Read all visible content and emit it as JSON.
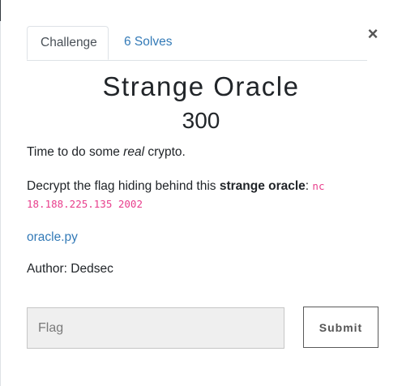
{
  "modal": {
    "close_symbol": "×",
    "tabs": [
      {
        "label": "Challenge"
      },
      {
        "label": "6 Solves"
      }
    ],
    "challenge": {
      "name": "Strange Oracle",
      "value": "300",
      "description": {
        "intro_before": "Time to do some ",
        "intro_emphasis": "real",
        "intro_after": " crypto.",
        "decrypt_before": "Decrypt the flag hiding behind this ",
        "decrypt_strong": "strange oracle",
        "decrypt_after": ": ",
        "command_part1": "nc",
        "command_part2": "18.188.225.135 2002",
        "file_link": "oracle.py",
        "author": "Author: Dedsec"
      }
    },
    "flag_input": {
      "placeholder": "Flag",
      "value": ""
    },
    "submit_label": "Submit"
  }
}
